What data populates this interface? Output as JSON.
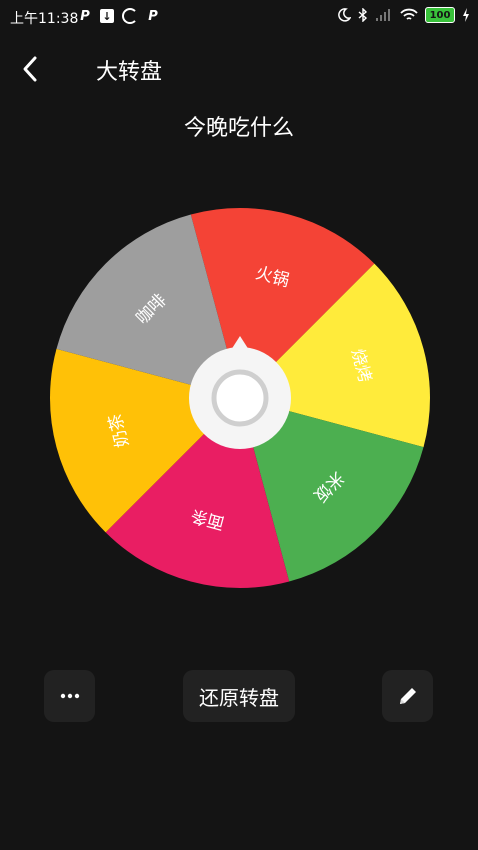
{
  "status_bar": {
    "time": "上午11:38",
    "battery": "100"
  },
  "header": {
    "title": "大转盘",
    "back_icon": "chevron-left-icon"
  },
  "wheel": {
    "title": "今晚吃什么",
    "slices": [
      {
        "label": "火锅",
        "color": "#F44336"
      },
      {
        "label": "烧烤",
        "color": "#FFEB3B"
      },
      {
        "label": "米饭",
        "color": "#4CAF50"
      },
      {
        "label": "面条",
        "color": "#E91E63"
      },
      {
        "label": "奶茶",
        "color": "#FFC107"
      },
      {
        "label": "咖啡",
        "color": "#9E9E9E"
      }
    ]
  },
  "actions": {
    "more_icon": "more-horizontal-icon",
    "restore_label": "还原转盘",
    "edit_icon": "pencil-icon"
  }
}
